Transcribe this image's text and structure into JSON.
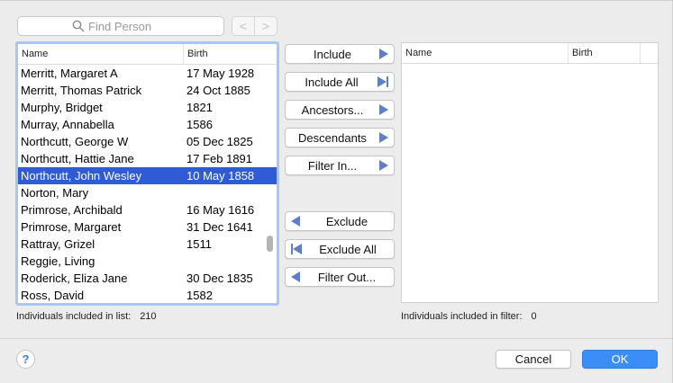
{
  "search": {
    "placeholder": "Find Person",
    "back_glyph": "<",
    "forward_glyph": ">"
  },
  "left_table": {
    "columns": [
      "Name",
      "Birth"
    ],
    "rows": [
      {
        "name": "Merritt, Margaret A",
        "birth": "17 May 1928"
      },
      {
        "name": "Merritt, Thomas Patrick",
        "birth": "24 Oct 1885"
      },
      {
        "name": "Murphy, Bridget",
        "birth": "1821"
      },
      {
        "name": "Murray, Annabella",
        "birth": "1586"
      },
      {
        "name": "Northcutt, George W",
        "birth": "05 Dec 1825"
      },
      {
        "name": "Northcutt, Hattie Jane",
        "birth": "17 Feb 1891"
      },
      {
        "name": "Northcutt, John Wesley",
        "birth": "10 May 1858",
        "selected": true
      },
      {
        "name": "Norton, Mary",
        "birth": ""
      },
      {
        "name": "Primrose, Archibald",
        "birth": "16 May 1616"
      },
      {
        "name": "Primrose, Margaret",
        "birth": "31 Dec 1641"
      },
      {
        "name": "Rattray, Grizel",
        "birth": "1511"
      },
      {
        "name": "Reggie, Living",
        "birth": ""
      },
      {
        "name": "Roderick, Eliza Jane",
        "birth": "30 Dec 1835"
      },
      {
        "name": "Ross, David",
        "birth": "1582"
      }
    ],
    "count_label": "Individuals included in list:",
    "count_value": "210"
  },
  "right_table": {
    "columns": [
      "Name",
      "Birth"
    ],
    "rows": [],
    "count_label": "Individuals included in filter:",
    "count_value": "0"
  },
  "buttons": {
    "include": "Include",
    "include_all": "Include All",
    "ancestors": "Ancestors...",
    "descendants": "Descendants",
    "filter_in": "Filter In...",
    "exclude": "Exclude",
    "exclude_all": "Exclude All",
    "filter_out": "Filter Out..."
  },
  "footer": {
    "help": "?",
    "cancel": "Cancel",
    "ok": "OK"
  },
  "colors": {
    "selection": "#2f5bd6",
    "accent": "#3b8ef5",
    "arrow": "#5d7fc7",
    "focus_ring": "#a8c6ef"
  }
}
